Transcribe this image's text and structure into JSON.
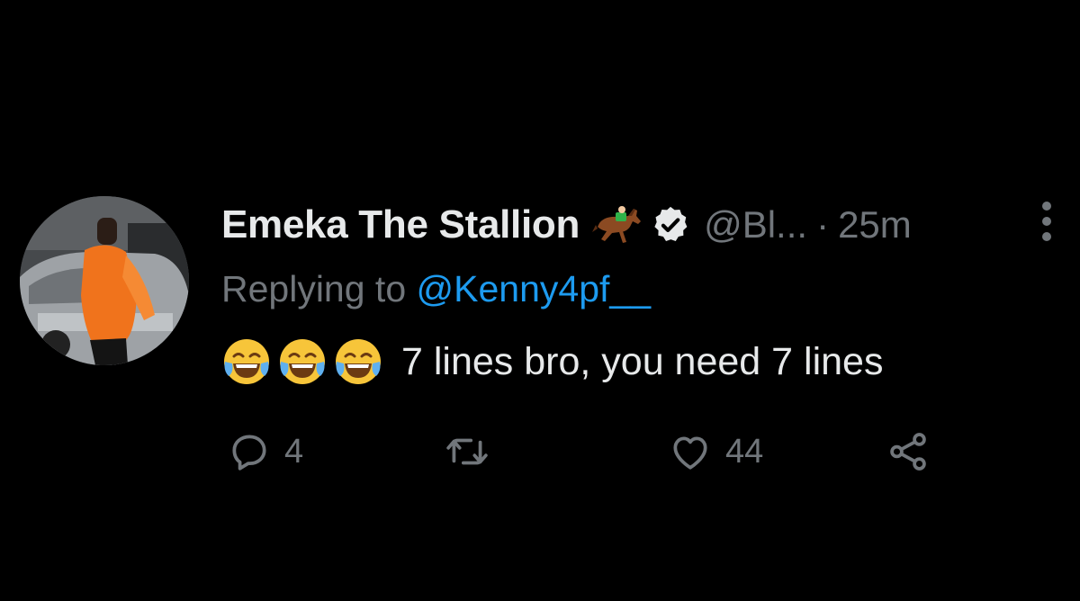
{
  "tweet": {
    "display_name": "Emeka The Stallion",
    "handle": "@Bl...",
    "separator": "·",
    "time": "25m",
    "replying_prefix": "Replying to ",
    "replying_to": "@Kenny4pf__",
    "text": "7 lines bro, you need 7 lines",
    "emoji_name": "face-with-tears-of-joy",
    "emoji_count": 3
  },
  "actions": {
    "reply_count": "4",
    "retweet_count": "",
    "like_count": "44"
  },
  "colors": {
    "background": "#000000",
    "primary_text": "#e7e9ea",
    "secondary_text": "#71767b",
    "link": "#1d9bf0",
    "avatar_jacket": "#f0731c"
  },
  "icons": {
    "name_emoji": "horse-racing-icon",
    "verified": "verified-badge-icon",
    "more": "more-vertical-icon",
    "reply": "reply-icon",
    "retweet": "retweet-icon",
    "like": "heart-icon",
    "share": "share-icon"
  }
}
